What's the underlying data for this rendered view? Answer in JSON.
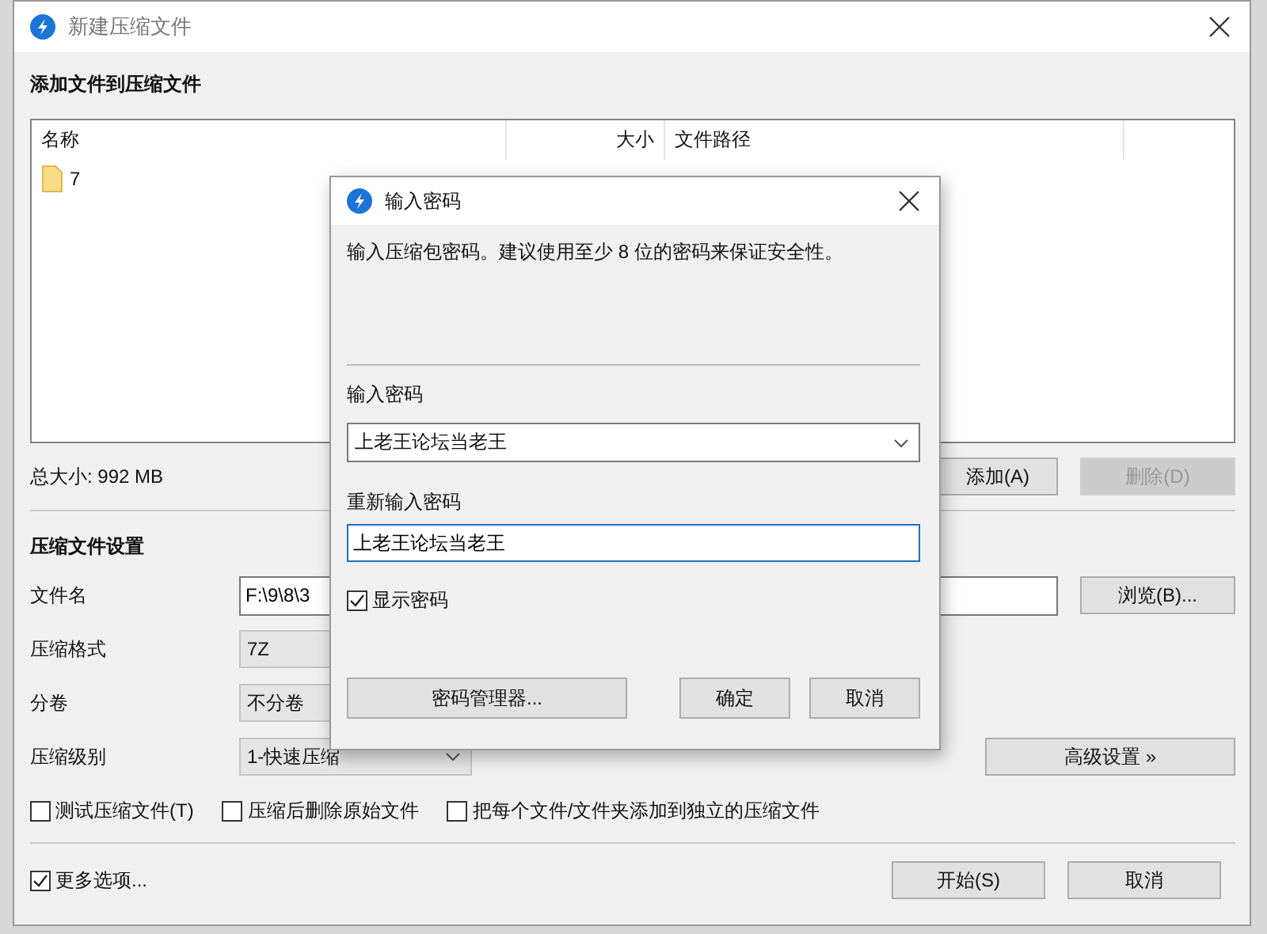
{
  "window": {
    "title": "新建压缩文件"
  },
  "files_section": {
    "heading": "添加文件到压缩文件",
    "columns": [
      "名称",
      "大小",
      "文件路径"
    ],
    "rows": [
      {
        "name": "7"
      }
    ],
    "total": "总大小: 992 MB",
    "buttons": [
      {
        "label": "添加(A)",
        "disabled": false
      },
      {
        "label": "删除(D)",
        "disabled": true
      }
    ]
  },
  "settings": {
    "heading": "压缩文件设置",
    "fields": [
      {
        "kind": "text",
        "label": "文件名",
        "value": "F:\\9\\8\\3",
        "button": "浏览(B)..."
      },
      {
        "kind": "box",
        "label": "压缩格式",
        "value": "7Z"
      },
      {
        "kind": "box",
        "label": "分卷",
        "value": "不分卷"
      },
      {
        "kind": "dropdown",
        "label": "压缩级别",
        "value": "1-快速压缩",
        "button": "高级设置 »"
      }
    ],
    "options": [
      {
        "label": "测试压缩文件(T)",
        "checked": false
      },
      {
        "label": "压缩后删除原始文件",
        "checked": false
      },
      {
        "label": "把每个文件/文件夹添加到独立的压缩文件",
        "checked": false
      }
    ]
  },
  "more_options": {
    "label": "更多选项...",
    "checked": true
  },
  "buttons": [
    "开始(S)",
    "取消"
  ],
  "dialog": {
    "title": "输入密码",
    "hint": "输入压缩包密码。建议使用至少 8 位的密码来保证安全性。",
    "password_label": "输入密码",
    "password": "上老王论坛当老王",
    "confirm_label": "重新输入密码",
    "confirm": "上老王论坛当老王",
    "show_password": {
      "label": "显示密码",
      "checked": true
    },
    "manager_button": "密码管理器...",
    "buttons": [
      "确定",
      "取消"
    ]
  }
}
